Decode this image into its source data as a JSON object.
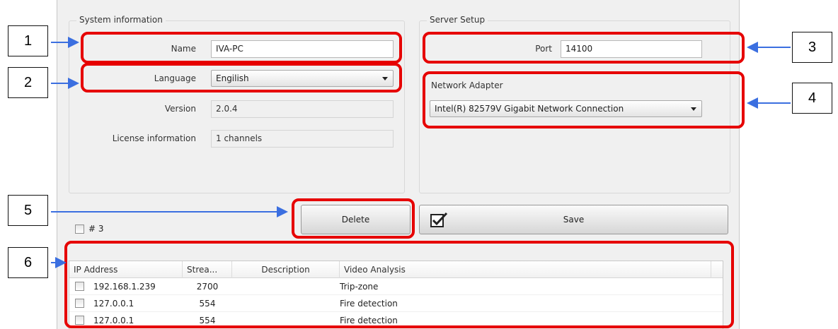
{
  "system_info": {
    "title": "System information",
    "name_label": "Name",
    "name_value": "IVA-PC",
    "language_label": "Language",
    "language_value": "Engilish",
    "version_label": "Version",
    "version_value": "2.0.4",
    "license_label": "License information",
    "license_value": "1 channels"
  },
  "server_setup": {
    "title": "Server Setup",
    "port_label": "Port",
    "port_value": "14100",
    "adapter_label": "Network Adapter",
    "adapter_value": "Intel(R) 82579V Gigabit Network Connection"
  },
  "actions": {
    "delete_label": "Delete",
    "save_label": "Save",
    "select_count": "# 3"
  },
  "table": {
    "columns": [
      "IP Address",
      "Strea...",
      "Description",
      "Video Analysis"
    ],
    "rows": [
      {
        "ip": "192.168.1.239",
        "stream": "2700",
        "description": "",
        "analysis": "Trip-zone"
      },
      {
        "ip": "127.0.0.1",
        "stream": "554",
        "description": "",
        "analysis": "Fire detection"
      },
      {
        "ip": "127.0.0.1",
        "stream": "554",
        "description": "",
        "analysis": "Fire detection"
      }
    ]
  },
  "callouts": [
    "1",
    "2",
    "3",
    "4",
    "5",
    "6"
  ],
  "colors": {
    "highlight": "#e60000",
    "arrow": "#3b6fe0"
  }
}
